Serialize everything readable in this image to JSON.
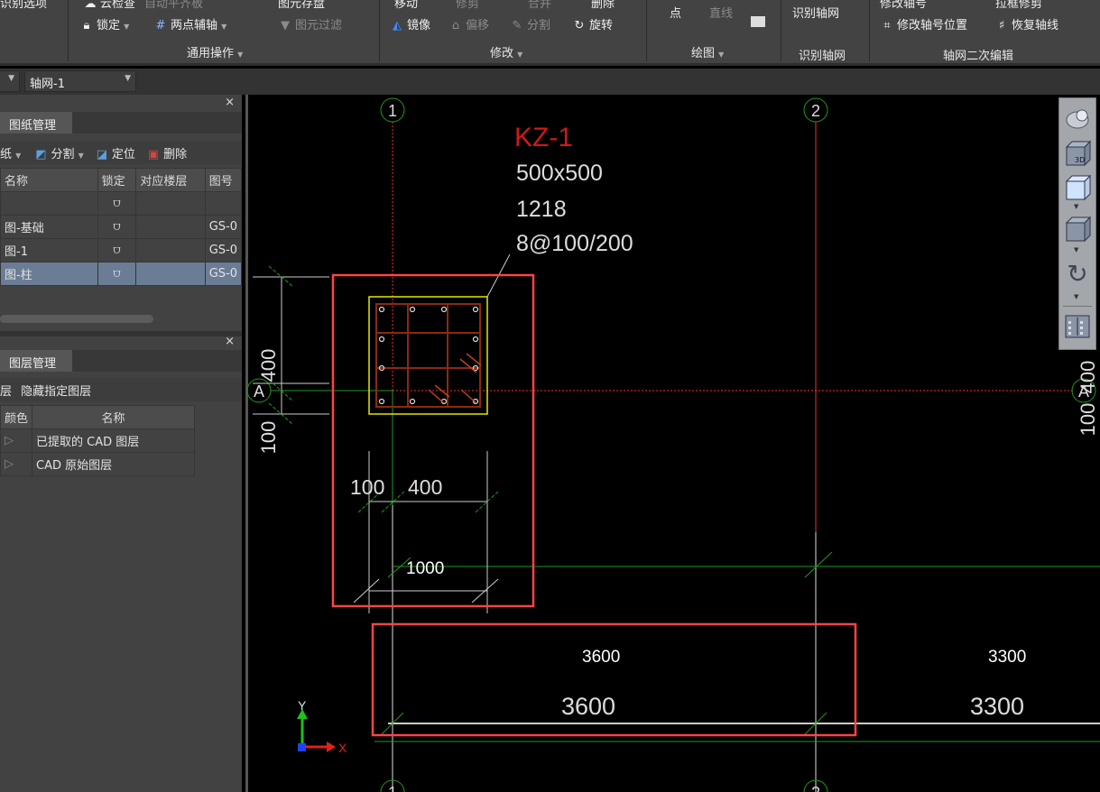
{
  "ribbon": {
    "row1": {
      "select_option": "识别选项",
      "cloud_check": "云检查",
      "auto_align": "自动平齐板",
      "save_elements": "图元存盘",
      "move": "移动",
      "trim": "修剪",
      "merge": "合并",
      "delete": "删除",
      "modify_axis_no": "修改轴号",
      "box_trim": "拉框修剪"
    },
    "lock": "锁定",
    "two_point_axis": "两点辅轴",
    "element_filter": "图元过滤",
    "mirror": "镜像",
    "offset": "偏移",
    "split": "分割",
    "rotate": "旋转",
    "point": "点",
    "line": "直线",
    "identify_grid": "识别轴网",
    "modify_axis_pos": "修改轴号位置",
    "restore_axis": "恢复轴线",
    "groups": {
      "general": "通用操作",
      "modify": "修改",
      "draw": "绘图",
      "identify": "识别轴网",
      "grid_edit": "轴网二次编辑"
    }
  },
  "bar2": {
    "grid_select": "轴网-1"
  },
  "drawing_panel": {
    "tab": "图纸管理",
    "tools": {
      "drawing": "纸",
      "split": "分割",
      "locate": "定位",
      "delete": "删除"
    },
    "columns": [
      "名称",
      "锁定",
      "对应楼层",
      "图号"
    ],
    "rows": [
      {
        "name": "",
        "floor": "",
        "code": ""
      },
      {
        "name": "图-基础",
        "floor": "",
        "code": "GS-0"
      },
      {
        "name": "图-1",
        "floor": "",
        "code": "GS-0"
      },
      {
        "name": "图-柱",
        "floor": "",
        "code": "GS-0",
        "selected": true
      }
    ]
  },
  "layer_panel": {
    "tab": "图层管理",
    "tools": {
      "show": "层",
      "hide": "隐藏指定图层"
    },
    "columns": [
      "颜色",
      "名称"
    ],
    "rows": [
      "已提取的 CAD 图层",
      "CAD 原始图层"
    ]
  },
  "cad": {
    "axis_1": "1",
    "axis_2": "2",
    "axis_a": "A",
    "column_name": "KZ-1",
    "column_size": "500x500",
    "column_rebar": "1218",
    "column_stirrup": "8@100/200",
    "dim_400_v": "400",
    "dim_100_v": "100",
    "dim_100_h": "100",
    "dim_400_h": "400",
    "dim_1000": "1000",
    "span_3600_label": "3600",
    "span_3600_dim": "3600",
    "span_3300_label": "3300",
    "span_3300_dim": "3300",
    "edge_400": "400",
    "edge_100": "100",
    "ucs_x": "X",
    "ucs_y": "Y",
    "colors": {
      "highlight_box": "#ff4444",
      "column_outline": "#e6e600",
      "rebar": "#8b2a10",
      "axis_red": "#ff2a2a",
      "axis_green": "#1f9a1f"
    }
  }
}
